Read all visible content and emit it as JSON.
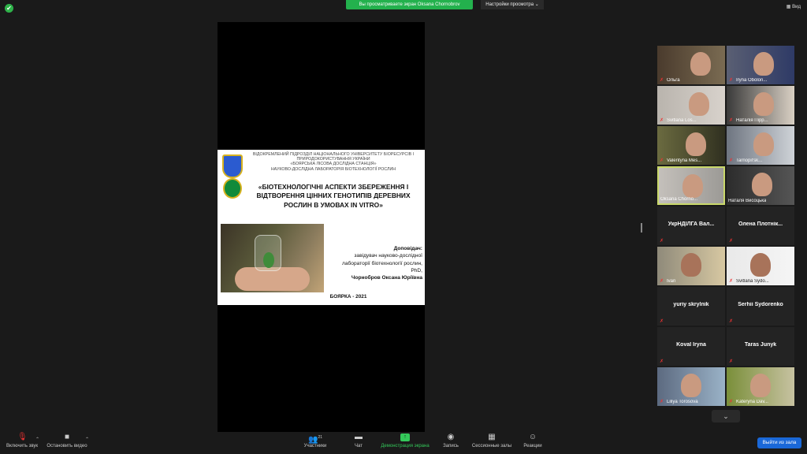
{
  "top": {
    "share_banner": "Вы просматриваете экран Oksana Chornobrov",
    "view_settings": "Настройки просмотра ⌄",
    "view_button": "Вид"
  },
  "slide": {
    "org": "ВІДОКРЕМЛЕНИЙ ПІДРОЗДІЛ НАЦІОНАЛЬНОГО УНІВЕРСИТЕТУ БІОРЕСУРСІВ І\nПРИРОДОКОРИСТУВАННЯ УКРАЇНИ\n«БОЯРСЬКА ЛІСОВА ДОСЛІДНА СТАНЦІЯ»\nНАУКОВО-ДОСЛІДНА ЛАБОРАТОРІЯ БІОТЕХНОЛОГІЇ РОСЛИН",
    "title": "«БІОТЕХНОЛОГІЧНІ АСПЕКТИ ЗБЕРЕЖЕННЯ І\nВІДТВОРЕННЯ ЦІННИХ ГЕНОТИПІВ ДЕРЕВНИХ\nРОСЛИН В УМОВАХ IN VITRO»",
    "speaker_label": "Доповідач:",
    "speaker_line1": "завідувач науково-дослідної",
    "speaker_line2": "лабораторії біотехнології рослин,",
    "speaker_line3": "PhD,",
    "speaker_name": "Чорнобров Оксана Юріївна",
    "city_year": "БОЯРКА - 2021"
  },
  "participants": [
    {
      "name": "Ольга",
      "video": true
    },
    {
      "name": "Iryna Obolon...",
      "video": true
    },
    {
      "name": "Svitlana Los...",
      "video": true
    },
    {
      "name": "Наталія Пірр...",
      "video": true
    },
    {
      "name": "Valentyna Mes...",
      "video": true
    },
    {
      "name": "Tarnopil'sk...",
      "video": true
    },
    {
      "name": "Oksana Chorno...",
      "video": true
    },
    {
      "name": "Наталя Висоцька",
      "video": true
    },
    {
      "name": "УкрНДІЛГА Вал...",
      "video": false
    },
    {
      "name": "Олена  Плотнік...",
      "video": false
    },
    {
      "name": "Ivan",
      "video": true
    },
    {
      "name": "Svitlana Sydo...",
      "video": true
    },
    {
      "name": "yuriy skrylnik",
      "video": false
    },
    {
      "name": "Serhii Sydorenko",
      "video": false
    },
    {
      "name": "Koval  Iryna",
      "video": false
    },
    {
      "name": "Taras Junyk",
      "video": false
    },
    {
      "name": "Liliya Torosova",
      "video": true
    },
    {
      "name": "Kateryna Dav...",
      "video": true
    }
  ],
  "toolbar": {
    "mute": "Включить звук",
    "video": "Остановить видео",
    "participants": "Участники",
    "participants_count": "21",
    "chat": "Чат",
    "share": "Демонстрация экрана",
    "record": "Запись",
    "rooms": "Сессионные залы",
    "reactions": "Реакции",
    "leave": "Выйти из зала"
  }
}
